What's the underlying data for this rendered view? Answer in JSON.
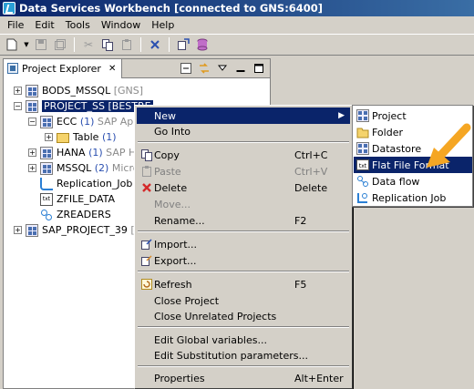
{
  "window": {
    "title": "Data Services Workbench [connected to GNS:6400]"
  },
  "menubar": [
    "File",
    "Edit",
    "Tools",
    "Window",
    "Help"
  ],
  "panel": {
    "tab_label": "Project Explorer",
    "close_glyph": "✕"
  },
  "tree": [
    {
      "label": "BODS_MSSQL",
      "suffix": "[GNS]",
      "icon": "datastore-icon"
    },
    {
      "label": "PROJECT_SS [BESTRE",
      "suffix": "",
      "icon": "datastore-icon",
      "selected": true
    },
    {
      "label": "ECC",
      "count": "(1)",
      "suffix": "SAP App",
      "icon": "datastore-icon"
    },
    {
      "label": "Table",
      "count": "(1)",
      "suffix": "",
      "icon": "folder-icon"
    },
    {
      "label": "HANA",
      "count": "(1)",
      "suffix": "SAP H",
      "icon": "datastore-icon"
    },
    {
      "label": "MSSQL",
      "count": "(2)",
      "suffix": "Micro",
      "icon": "datastore-icon"
    },
    {
      "label": "Replication_Job",
      "suffix": "",
      "icon": "job-icon"
    },
    {
      "label": "ZFILE_DATA",
      "suffix": "",
      "icon": "txt-icon"
    },
    {
      "label": "ZREADERS",
      "suffix": "",
      "icon": "dataflow-icon"
    },
    {
      "label": "SAP_PROJECT_39",
      "suffix": "[",
      "icon": "datastore-icon"
    }
  ],
  "context_menu": {
    "new": "New",
    "go_into": "Go Into",
    "copy": "Copy",
    "copy_key": "Ctrl+C",
    "paste": "Paste",
    "paste_key": "Ctrl+V",
    "delete": "Delete",
    "delete_key": "Delete",
    "move": "Move...",
    "rename": "Rename...",
    "rename_key": "F2",
    "import": "Import...",
    "export": "Export...",
    "refresh": "Refresh",
    "refresh_key": "F5",
    "close_project": "Close Project",
    "close_unrelated": "Close Unrelated Projects",
    "edit_global": "Edit Global variables...",
    "edit_subst": "Edit Substitution parameters...",
    "properties": "Properties",
    "properties_key": "Alt+Enter"
  },
  "submenu": {
    "project": "Project",
    "folder": "Folder",
    "datastore": "Datastore",
    "flat_file": "Flat File Format",
    "data_flow": "Data flow",
    "replication_job": "Replication Job"
  },
  "colors": {
    "selection": "#0a246a",
    "annotation_arrow": "#f5a623",
    "delete_icon": "#d42a2a"
  }
}
